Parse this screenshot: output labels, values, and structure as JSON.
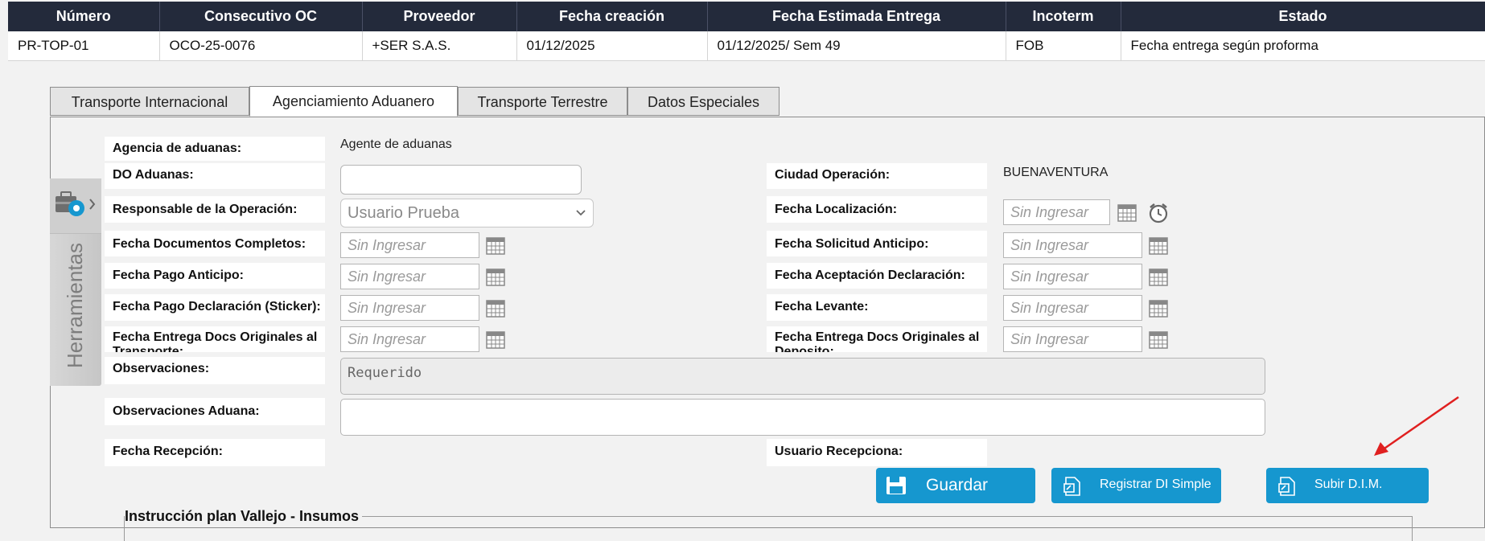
{
  "order_table": {
    "headers": [
      "Número",
      "Consecutivo OC",
      "Proveedor",
      "Fecha creación",
      "Fecha Estimada Entrega",
      "Incoterm",
      "Estado"
    ],
    "row": [
      "PR-TOP-01",
      "OCO-25-0076",
      "+SER S.A.S.",
      "01/12/2025",
      "01/12/2025/ Sem 49",
      "FOB",
      "Fecha entrega según proforma"
    ]
  },
  "tabs": [
    {
      "label": "Transporte Internacional",
      "active": false
    },
    {
      "label": "Agenciamiento Aduanero",
      "active": true
    },
    {
      "label": "Transporte Terrestre",
      "active": false
    },
    {
      "label": "Datos Especiales",
      "active": false
    }
  ],
  "side_tools": {
    "label": "Herramientas",
    "icon": "toolbox-gear-icon"
  },
  "form": {
    "agencia_label": "Agencia de aduanas:",
    "agencia_value": "Agente de aduanas",
    "do_label": "DO Aduanas:",
    "do_value": "",
    "ciudad_label": "Ciudad Operación:",
    "ciudad_value": "BUENAVENTURA",
    "responsable_label": "Responsable de la Operación:",
    "responsable_value": "Usuario Prueba",
    "fecha_localizacion_label": "Fecha Localización:",
    "fecha_docs_completos_label": "Fecha Documentos Completos:",
    "fecha_solicitud_anticipo_label": "Fecha Solicitud Anticipo:",
    "fecha_pago_anticipo_label": "Fecha Pago Anticipo:",
    "fecha_aceptacion_label": "Fecha Aceptación Declaración:",
    "fecha_pago_declaracion_label": "Fecha Pago Declaración (Sticker):",
    "fecha_levante_label": "Fecha Levante:",
    "fecha_entrega_transporte_label": "Fecha Entrega Docs Originales al Transporte:",
    "fecha_entrega_deposito_label": "Fecha Entrega Docs Originales al Deposito:",
    "date_placeholder": "Sin Ingresar",
    "observaciones_label": "Observaciones:",
    "observaciones_value": "Requerido",
    "observaciones_aduana_label": "Observaciones Aduana:",
    "observaciones_aduana_value": "",
    "fecha_recepcion_label": "Fecha Recepción:",
    "usuario_recepciona_label": "Usuario Recepciona:"
  },
  "buttons": {
    "guardar": "Guardar",
    "registrar": "Registrar DI Simple",
    "subir": "Subir D.I.M."
  },
  "section": {
    "legend": "Instrucción plan Vallejo - Insumos"
  },
  "colors": {
    "header_bg": "#232a3b",
    "button_bg": "#1697cf",
    "arrow": "#e02020"
  }
}
